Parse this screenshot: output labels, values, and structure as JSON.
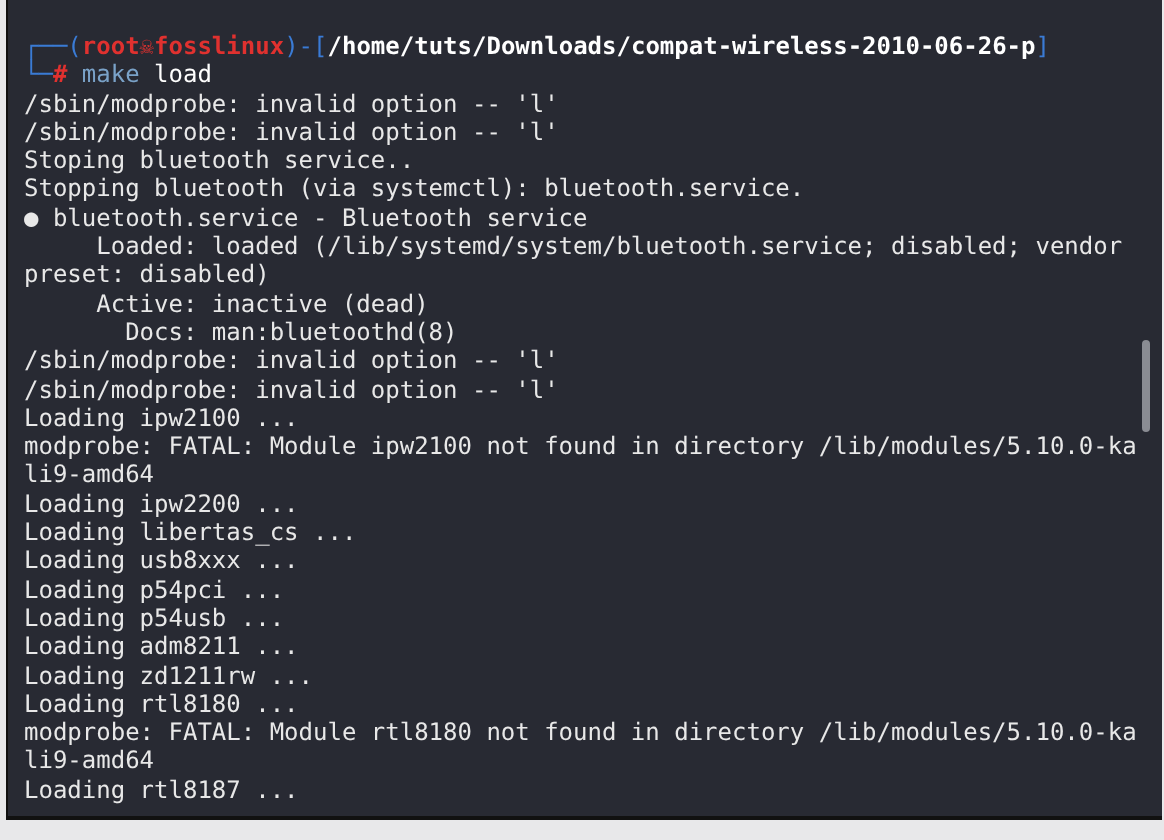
{
  "prompt": {
    "user_host": [
      {
        "kind": "frame",
        "text": "┌──("
      },
      {
        "kind": "user",
        "text": "root☠fosslinux"
      },
      {
        "kind": "frame",
        "text": ")-["
      },
      {
        "kind": "path",
        "text": "/home/tuts/Downloads/compat-wireless-2010-06-26-p"
      },
      {
        "kind": "frame",
        "text": "]"
      }
    ],
    "command_line": [
      {
        "kind": "frame",
        "text": "└─"
      },
      {
        "kind": "user",
        "text": "#"
      },
      {
        "kind": "command",
        "text": " make"
      },
      {
        "kind": "arg",
        "text": " load"
      }
    ]
  },
  "output": [
    "/sbin/modprobe: invalid option -- 'l'",
    "/sbin/modprobe: invalid option -- 'l'",
    "Stoping bluetooth service..",
    "Stopping bluetooth (via systemctl): bluetooth.service.",
    "● bluetooth.service - Bluetooth service",
    "     Loaded: loaded (/lib/systemd/system/bluetooth.service; disabled; vendor",
    "preset: disabled)",
    "     Active: inactive (dead)",
    "       Docs: man:bluetoothd(8)",
    "/sbin/modprobe: invalid option -- 'l'",
    "/sbin/modprobe: invalid option -- 'l'",
    "Loading ipw2100 ...",
    "modprobe: FATAL: Module ipw2100 not found in directory /lib/modules/5.10.0-ka",
    "li9-amd64",
    "Loading ipw2200 ...",
    "Loading libertas_cs ...",
    "Loading usb8xxx ...",
    "Loading p54pci ...",
    "Loading p54usb ...",
    "Loading adm8211 ...",
    "Loading zd1211rw ...",
    "Loading rtl8180 ...",
    "modprobe: FATAL: Module rtl8180 not found in directory /lib/modules/5.10.0-ka",
    "li9-amd64",
    "Loading rtl8187 ..."
  ]
}
